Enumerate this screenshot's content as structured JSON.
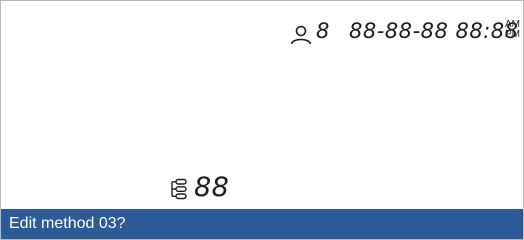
{
  "header": {
    "user_icon": "user-icon",
    "user_count": "8",
    "datetime": "88-88-88 88:88",
    "am": "AM",
    "pm": "PM"
  },
  "method": {
    "icon": "method-list-icon",
    "number": "88"
  },
  "status_bar": {
    "text": "Edit method 03?",
    "color": "#2e5b97"
  }
}
